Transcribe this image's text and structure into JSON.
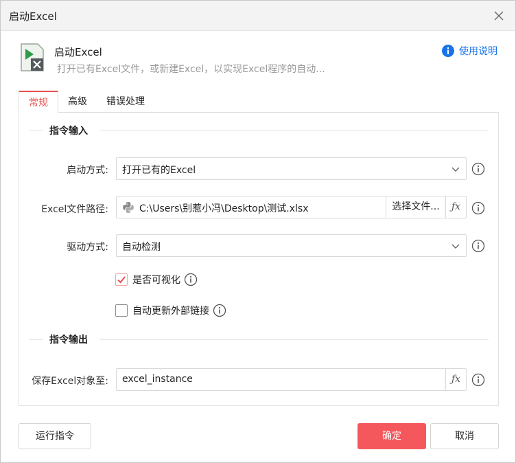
{
  "window": {
    "title": "启动Excel"
  },
  "header": {
    "title": "启动Excel",
    "description": "打开已有Excel文件，或新建Excel，以实现Excel程序的自动...",
    "help_label": "使用说明"
  },
  "tabs": [
    {
      "label": "常规",
      "active": true
    },
    {
      "label": "高级",
      "active": false
    },
    {
      "label": "错误处理",
      "active": false
    }
  ],
  "sections": {
    "input": "指令输入",
    "output": "指令输出"
  },
  "fields": {
    "launch_mode": {
      "label": "启动方式:",
      "value": "打开已有的Excel"
    },
    "file_path": {
      "label": "Excel文件路径:",
      "value": "C:\\Users\\别惹小冯\\Desktop\\测试.xlsx",
      "button": "选择文件..."
    },
    "driver": {
      "label": "驱动方式:",
      "value": "自动检测"
    },
    "visible": {
      "label": "是否可视化",
      "checked": true
    },
    "update_links": {
      "label": "自动更新外部链接",
      "checked": false
    },
    "save_to": {
      "label": "保存Excel对象至:",
      "value": "excel_instance"
    }
  },
  "footer": {
    "run_label": "运行指令",
    "ok_label": "确定",
    "cancel_label": "取消"
  },
  "colors": {
    "accent": "#e8504f",
    "primary_button": "#f5585c",
    "link": "#1a73e8"
  }
}
